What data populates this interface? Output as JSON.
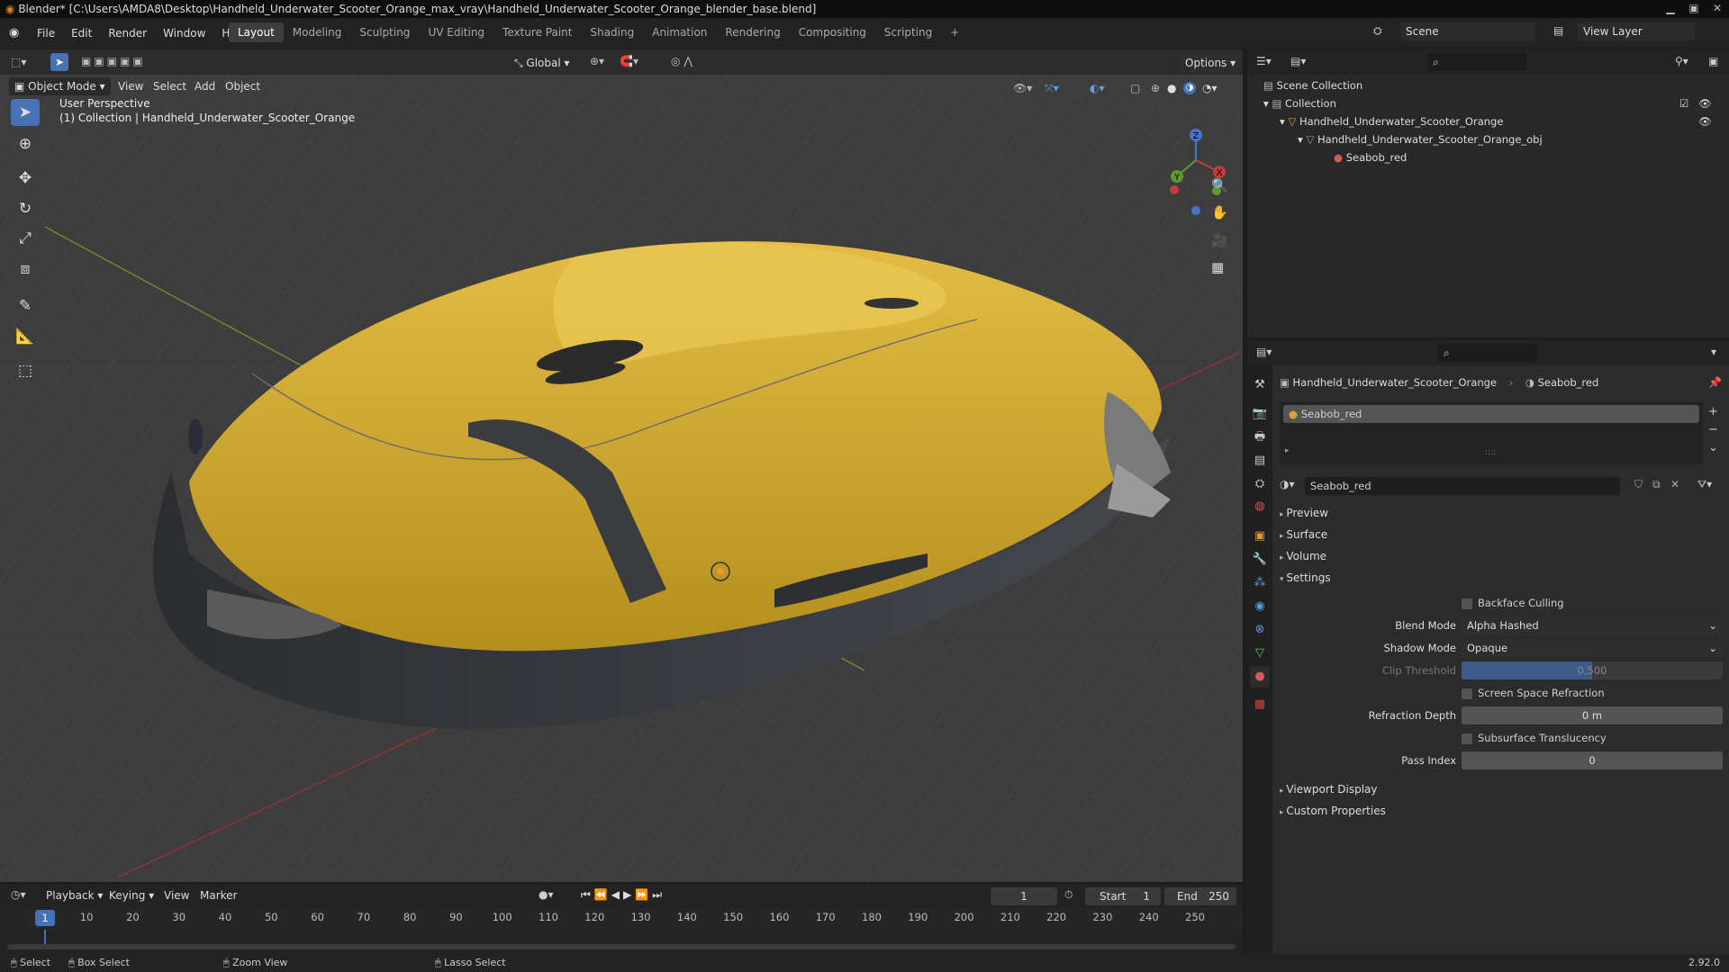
{
  "app": {
    "title": "Blender* [C:\\Users\\AMDA8\\Desktop\\Handheld_Underwater_Scooter_Orange_max_vray\\Handheld_Underwater_Scooter_Orange_blender_base.blend]",
    "version": "2.92.0"
  },
  "menus": [
    "File",
    "Edit",
    "Render",
    "Window",
    "Help"
  ],
  "workspaces": [
    "Layout",
    "Modeling",
    "Sculpting",
    "UV Editing",
    "Texture Paint",
    "Shading",
    "Animation",
    "Rendering",
    "Compositing",
    "Scripting"
  ],
  "workspace_add": "+",
  "scene": {
    "name": "Scene",
    "view_layer": "View Layer"
  },
  "viewport": {
    "mode": "Object Mode",
    "menus": [
      "View",
      "Select",
      "Add",
      "Object"
    ],
    "orientation": "Global",
    "options": "Options",
    "perspective": "User Perspective",
    "collection_info": "(1) Collection | Handheld_Underwater_Scooter_Orange",
    "gizmo": {
      "x": "X",
      "y": "Y",
      "z": "Z"
    }
  },
  "outliner": {
    "items": [
      {
        "label": "Scene Collection",
        "depth": 0
      },
      {
        "label": "Collection",
        "depth": 1
      },
      {
        "label": "Handheld_Underwater_Scooter_Orange",
        "depth": 2
      },
      {
        "label": "Handheld_Underwater_Scooter_Orange_obj",
        "depth": 3
      },
      {
        "label": "Seabob_red",
        "depth": 4
      }
    ]
  },
  "properties": {
    "breadcrumb_object": "Handheld_Underwater_Scooter_Orange",
    "breadcrumb_material": "Seabob_red",
    "slot": "Seabob_red",
    "material_name": "Seabob_red",
    "sections": {
      "preview": "Preview",
      "surface": "Surface",
      "volume": "Volume",
      "settings": "Settings",
      "viewport_display": "Viewport Display",
      "custom_properties": "Custom Properties"
    },
    "settings": {
      "backface_culling": "Backface Culling",
      "blend_mode_label": "Blend Mode",
      "blend_mode": "Alpha Hashed",
      "shadow_mode_label": "Shadow Mode",
      "shadow_mode": "Opaque",
      "clip_threshold_label": "Clip Threshold",
      "clip_threshold": "0.500",
      "clip_fraction": 0.5,
      "ssr": "Screen Space Refraction",
      "refraction_depth_label": "Refraction Depth",
      "refraction_depth": "0 m",
      "subsurface": "Subsurface Translucency",
      "pass_index_label": "Pass Index",
      "pass_index": "0"
    }
  },
  "timeline": {
    "menus": [
      "Playback",
      "Keying",
      "View",
      "Marker"
    ],
    "current_frame": "1",
    "start_label": "Start",
    "start": "1",
    "end_label": "End",
    "end": "250",
    "ticks": [
      "1",
      "10",
      "20",
      "30",
      "40",
      "50",
      "60",
      "70",
      "80",
      "90",
      "100",
      "110",
      "120",
      "130",
      "140",
      "150",
      "160",
      "170",
      "180",
      "190",
      "200",
      "210",
      "220",
      "230",
      "240",
      "250"
    ]
  },
  "status": {
    "select": "Select",
    "box_select": "Box Select",
    "zoom_view": "Zoom View",
    "lasso_select": "Lasso Select"
  },
  "colors": {
    "accent": "#4772b3",
    "scooter": "#d9b23c",
    "viewport": "#3e3e3e"
  }
}
